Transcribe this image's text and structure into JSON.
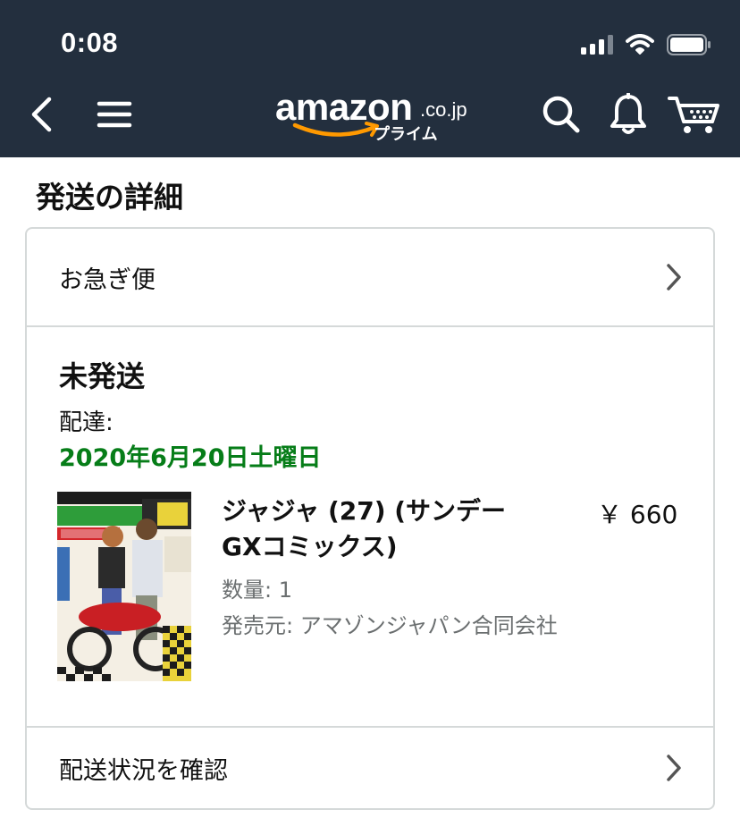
{
  "status_bar": {
    "time": "0:08"
  },
  "header": {
    "logo_word": "amazon",
    "logo_domain": ".co.jp",
    "logo_sub": "プライム"
  },
  "page": {
    "title": "発送の詳細"
  },
  "shipping": {
    "speed_label": "お急ぎ便",
    "status": "未発送",
    "delivery_label": "配達:",
    "delivery_date": "2020年6月20日土曜日",
    "track_label": "配送状況を確認"
  },
  "item": {
    "title": "ジャジャ (27) (サンデーGXコミックス)",
    "price": "￥ 660",
    "quantity": "数量: 1",
    "seller": "発売元: アマゾンジャパン合同会社"
  },
  "colors": {
    "header_bg": "#232f3e",
    "delivery_green": "#067d18",
    "smile_orange": "#ff9900"
  },
  "icons": [
    "back-icon",
    "menu-icon",
    "search-icon",
    "bell-icon",
    "cart-icon",
    "chevron-right-icon",
    "signal-icon",
    "wifi-icon",
    "battery-icon"
  ]
}
